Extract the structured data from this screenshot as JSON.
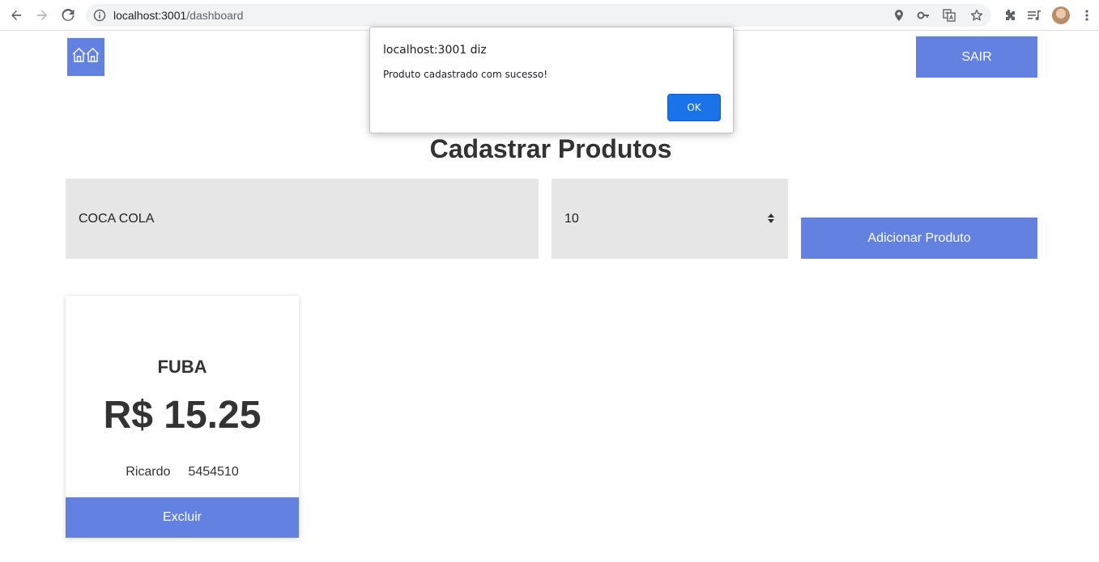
{
  "browser": {
    "url_host": "localhost:3001",
    "url_path": "/dashboard",
    "icons": [
      "back-icon",
      "forward-icon",
      "reload-icon",
      "info-icon",
      "location-icon",
      "key-icon",
      "translate-icon",
      "star-icon",
      "extensions-icon",
      "media-queue-icon",
      "avatar",
      "menu-icon"
    ]
  },
  "header": {
    "logo_icon": "home-icon",
    "logout_label": "SAIR"
  },
  "page": {
    "title": "Cadastrar Produtos"
  },
  "form": {
    "name_value": "COCA COLA",
    "price_value": "10",
    "add_label": "Adicionar Produto"
  },
  "products": [
    {
      "name": "FUBA",
      "price": "R$ 15.25",
      "owner": "Ricardo",
      "code": "5454510",
      "delete_label": "Excluir"
    }
  ],
  "dialog": {
    "title": "localhost:3001 diz",
    "message": "Produto cadastrado com sucesso!",
    "ok_label": "OK"
  },
  "colors": {
    "accent": "#6281e0",
    "field_bg": "#e6e6e6",
    "dialog_button": "#1a73e8"
  }
}
